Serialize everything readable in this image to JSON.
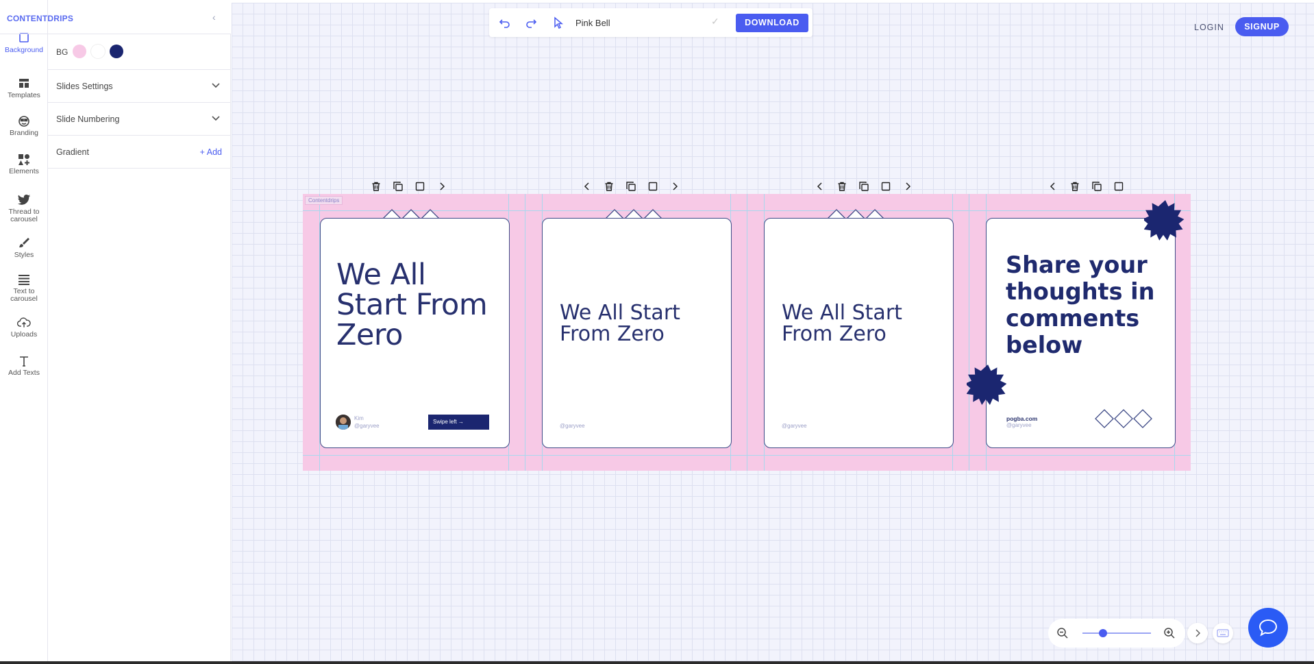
{
  "app": {
    "brand": "CONTENTDRIPS",
    "collapse_glyph": "‹"
  },
  "rail": [
    {
      "label": "Background",
      "icon": "square-icon",
      "active": true
    },
    {
      "label": "Templates",
      "icon": "templates-icon"
    },
    {
      "label": "Branding",
      "icon": "branding-icon"
    },
    {
      "label": "Elements",
      "icon": "elements-icon"
    },
    {
      "label": "Thread to carousel",
      "icon": "twitter-icon"
    },
    {
      "label": "Styles",
      "icon": "brush-icon"
    },
    {
      "label": "Text to carousel",
      "icon": "lines-icon"
    },
    {
      "label": "Uploads",
      "icon": "cloud-upload-icon"
    },
    {
      "label": "Add Texts",
      "icon": "text-icon"
    }
  ],
  "panel": {
    "bg_label": "BG",
    "bg_colors": [
      "#f7c9e6",
      "#ffffff",
      "#1b2670"
    ],
    "slides_settings": "Slides Settings",
    "slide_numbering": "Slide Numbering",
    "gradient": "Gradient",
    "add_label": "+ Add"
  },
  "toolbar": {
    "file_name": "Pink Bell",
    "download_label": "DOWNLOAD"
  },
  "header": {
    "login_label": "LOGIN",
    "signup_label": "SIGNUP"
  },
  "canvas": {
    "tag_label": "Contentdrips",
    "slides": [
      {
        "title_lines": [
          "We All",
          "Start From",
          "Zero"
        ],
        "name": "Kim",
        "handle": "@garyvee",
        "swipe_label": "Swipe left →"
      },
      {
        "title_lines": [
          "We All Start",
          "From Zero"
        ],
        "handle": "@garyvee"
      },
      {
        "title_lines": [
          "We All Start",
          "From Zero"
        ],
        "handle": "@garyvee"
      },
      {
        "title_lines": [
          "Share your",
          "thoughts in",
          "comments",
          "below"
        ],
        "site": "pogba.com",
        "handle": "@garyvee"
      }
    ]
  },
  "colors": {
    "accent": "#4a5cf0",
    "slide_bg": "#f7c9e6",
    "navy": "#1b2670",
    "title": "#27306e"
  }
}
